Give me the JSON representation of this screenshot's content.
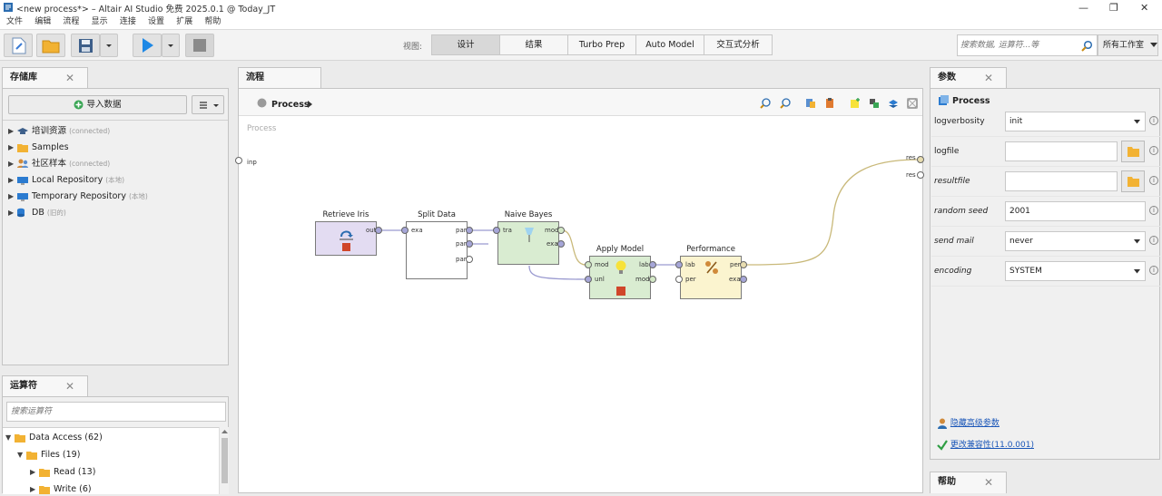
{
  "window": {
    "title": "<new process*> – Altair AI Studio 免费 2025.0.1 @ Today_JT"
  },
  "menu": [
    "文件",
    "编辑",
    "流程",
    "显示",
    "连接",
    "设置",
    "扩展",
    "帮助"
  ],
  "views": {
    "label": "视图:",
    "tabs": [
      "设计",
      "结果",
      "Turbo Prep",
      "Auto Model",
      "交互式分析"
    ],
    "active": "设计"
  },
  "search": {
    "placeholder": "搜索数据, 运算符...等",
    "scope": "所有工作室"
  },
  "repository": {
    "tab": "存储库",
    "import_button": "导入数据",
    "items": [
      {
        "name": "培训资源",
        "note": "(connected)"
      },
      {
        "name": "Samples",
        "note": ""
      },
      {
        "name": "社区样本",
        "note": "(connected)"
      },
      {
        "name": "Local Repository",
        "note": "(本地)"
      },
      {
        "name": "Temporary Repository",
        "note": "(本地)"
      },
      {
        "name": "DB",
        "note": "(旧的)"
      }
    ]
  },
  "operators": {
    "tab": "运算符",
    "search_placeholder": "搜索运算符",
    "tree": [
      {
        "label": "Data Access (62)"
      },
      {
        "label": "Files (19)"
      },
      {
        "label": "Read (13)"
      },
      {
        "label": "Write (6)"
      }
    ]
  },
  "process": {
    "tab": "流程",
    "breadcrumb": "Process",
    "canvas_title": "Process",
    "left_port": "inp",
    "right_ports": [
      "res",
      "res"
    ],
    "operators": [
      {
        "name": "Retrieve Iris",
        "ports_out": [
          "out"
        ]
      },
      {
        "name": "Split Data",
        "ports_in": [
          "exa"
        ],
        "ports_out": [
          "par",
          "par",
          "par"
        ]
      },
      {
        "name": "Naive Bayes",
        "ports_in": [
          "tra"
        ],
        "ports_out": [
          "mod",
          "exa"
        ]
      },
      {
        "name": "Apply Model",
        "ports_in": [
          "mod",
          "unl"
        ],
        "ports_out": [
          "lab",
          "mod"
        ]
      },
      {
        "name": "Performance",
        "ports_in": [
          "lab",
          "per"
        ],
        "ports_out": [
          "per",
          "exa"
        ]
      }
    ]
  },
  "parameters": {
    "tab": "参数",
    "operator": "Process",
    "rows": [
      {
        "label": "logverbosity",
        "value": "init",
        "type": "select",
        "italic": false
      },
      {
        "label": "logfile",
        "value": "",
        "type": "file",
        "italic": false
      },
      {
        "label": "resultfile",
        "value": "",
        "type": "file",
        "italic": true
      },
      {
        "label": "random seed",
        "value": "2001",
        "type": "text",
        "italic": true
      },
      {
        "label": "send mail",
        "value": "never",
        "type": "select",
        "italic": true
      },
      {
        "label": "encoding",
        "value": "SYSTEM",
        "type": "select",
        "italic": true
      }
    ],
    "hide_advanced": "隐藏高级参数",
    "compat": "更改兼容性(11.0.001)"
  },
  "help": {
    "tab": "帮助"
  },
  "colors": {
    "accent": "#1a73c8",
    "retrieve": "#e3dcf2",
    "model": "#d9ecd1",
    "perf": "#fbf4cf"
  }
}
